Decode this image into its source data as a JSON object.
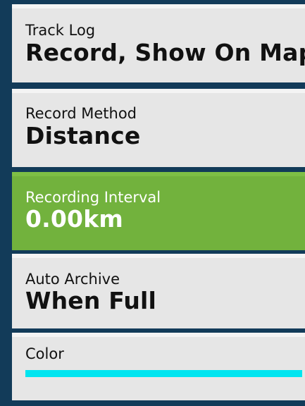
{
  "settings": {
    "items": [
      {
        "label": "Track Log",
        "value": "Record, Show On Map"
      },
      {
        "label": "Record Method",
        "value": "Distance"
      },
      {
        "label": "Recording Interval",
        "value": "0.00km"
      },
      {
        "label": "Auto Archive",
        "value": "When Full"
      },
      {
        "label": "Color",
        "swatch_color": "#00e5f0"
      }
    ],
    "selected_index": 2
  },
  "colors": {
    "background": "#123b59",
    "item_background": "#e6e6e6",
    "selected_background": "#72b23d"
  }
}
